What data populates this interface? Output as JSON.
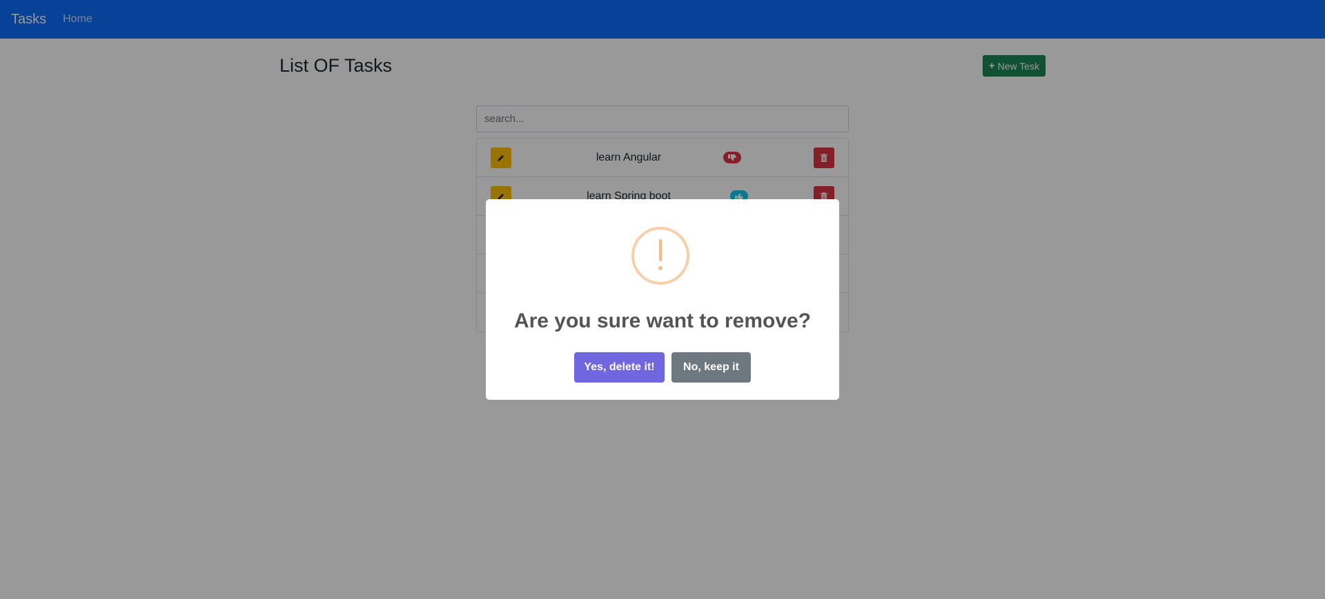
{
  "navbar": {
    "brand": "Tasks",
    "links": [
      "Home"
    ],
    "color": "#0d6efd"
  },
  "page": {
    "title": "List OF Tasks",
    "new_button_label": "New Tesk",
    "new_button_icon": "plus-icon"
  },
  "search": {
    "placeholder": "search..."
  },
  "tasks": [
    {
      "name": "learn Angular",
      "status_icon": "thumbs-down-icon",
      "status_color": "#dc3545"
    },
    {
      "name": "learn Spring boot",
      "status_icon": "thumbs-up-icon",
      "status_color": "#0dcaf0"
    },
    {
      "name": ""
    },
    {
      "name": ""
    },
    {
      "name": ""
    }
  ],
  "dialog": {
    "icon": "warning-icon",
    "icon_color": "#facea8",
    "title": "Are you sure want to remove?",
    "confirm_label": "Yes, delete it!",
    "cancel_label": "No, keep it",
    "confirm_color": "#7066e0",
    "cancel_color": "#6e7881"
  }
}
